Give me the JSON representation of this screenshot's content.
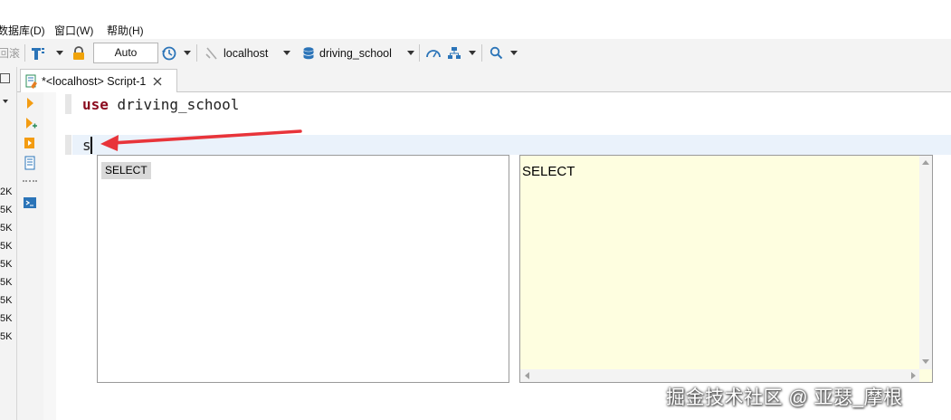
{
  "menubar": {
    "items": [
      {
        "label": "数据库(D)"
      },
      {
        "label": "窗口(W)"
      },
      {
        "label": "帮助(H)"
      }
    ]
  },
  "toolbar": {
    "rollback_label": "回滚",
    "transaction_mode": "Auto",
    "connection": "localhost",
    "database": "driving_school"
  },
  "tabs": [
    {
      "label": "*<localhost> Script-1"
    }
  ],
  "left_panel": {
    "sizes": [
      "2K",
      "5K",
      "5K",
      "5K",
      "5K",
      "5K",
      "5K",
      "5K",
      "5K"
    ]
  },
  "editor": {
    "line1_keyword": "use",
    "line1_rest": " driving_school",
    "line2_text": "s"
  },
  "autocomplete": {
    "items": [
      {
        "label": "SELECT"
      }
    ],
    "doc_text": "SELECT"
  },
  "annotation": {
    "arrow_color": "#e8343a"
  },
  "colors": {
    "keyword": "#8b0a1e",
    "current_line": "#eaf2fb",
    "doc_bg": "#fefee0"
  },
  "watermark": "掘金技术社区 @ 亚瑟_摩根"
}
